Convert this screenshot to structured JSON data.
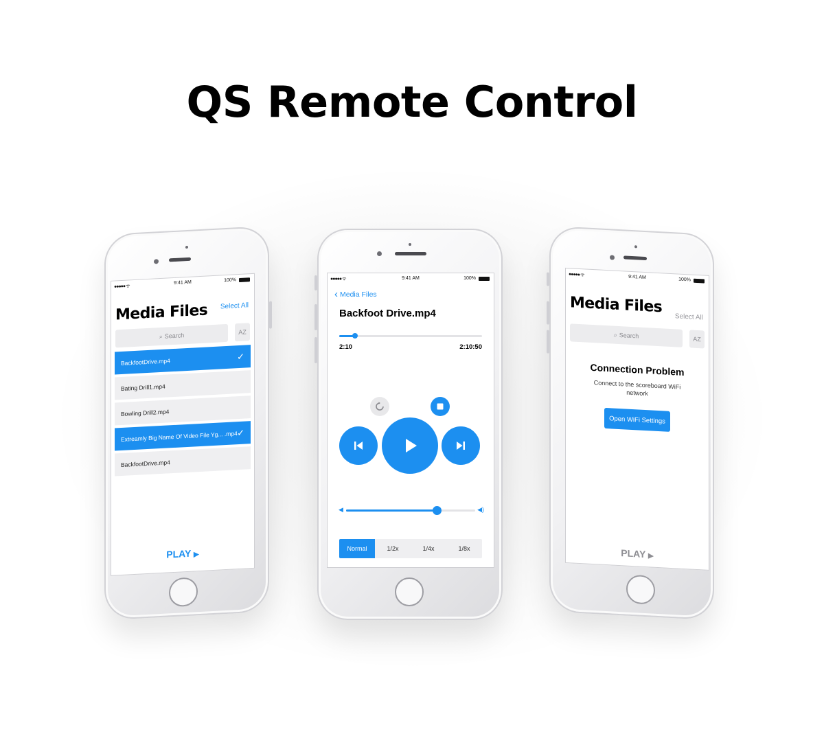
{
  "page_title": "QS Remote Control",
  "status_bar": {
    "signal": "●●●●● ᯤ",
    "time": "9:41 AM",
    "battery": "100%"
  },
  "left_phone": {
    "title": "Media Files",
    "select_all": "Select All",
    "search_placeholder": "Search",
    "sort_label": "AZ",
    "files": [
      {
        "name": "BackfootDrive.mp4",
        "selected": true
      },
      {
        "name": "Bating Drill1.mp4",
        "selected": false
      },
      {
        "name": "Bowling Drill2.mp4",
        "selected": false
      },
      {
        "name": "Extreamly Big Name Of Video File Yg... .mp4",
        "selected": true
      },
      {
        "name": "BackfootDrive.mp4",
        "selected": false
      }
    ],
    "play_label": "PLAY"
  },
  "center_phone": {
    "back_label": "Media Files",
    "file_title": "Backfoot Drive.mp4",
    "elapsed": "2:10",
    "total": "2:10:50",
    "progress_fraction": 0.11,
    "volume_fraction": 0.7,
    "speeds": [
      "Normal",
      "1/2x",
      "1/4x",
      "1/8x"
    ],
    "active_speed": "Normal"
  },
  "right_phone": {
    "title": "Media Files",
    "select_all": "Select All",
    "search_placeholder": "Search",
    "sort_label": "AZ",
    "problem_title": "Connection Problem",
    "problem_message": "Connect to the scoreboard WiFi network",
    "wifi_button": "Open WiFi Settings",
    "play_label": "PLAY"
  },
  "colors": {
    "accent": "#1c8ff0",
    "row_bg": "#efeff1",
    "disabled": "#8e8e93"
  },
  "icons": [
    "check-icon",
    "search-icon",
    "back-chevron-icon",
    "replay-icon",
    "stop-icon",
    "previous-icon",
    "play-icon",
    "next-icon",
    "volume-low-icon",
    "volume-high-icon",
    "play-triangle-icon"
  ]
}
